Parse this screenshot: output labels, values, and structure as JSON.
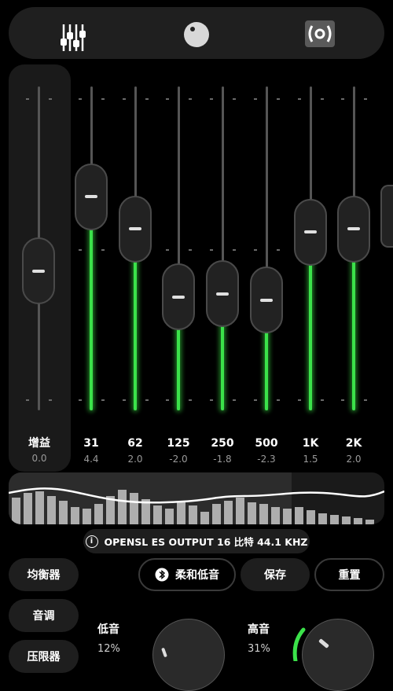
{
  "topbar": {
    "icons": [
      "equalizer-sliders-icon",
      "knob-icon",
      "surround-sound-icon"
    ]
  },
  "gain": {
    "label": "增益",
    "value": "0.0",
    "level": 0.43
  },
  "bands": [
    {
      "freq": "31",
      "value": "4.4",
      "level": 0.66
    },
    {
      "freq": "62",
      "value": "2.0",
      "level": 0.56
    },
    {
      "freq": "125",
      "value": "-2.0",
      "level": 0.35
    },
    {
      "freq": "250",
      "value": "-1.8",
      "level": 0.36
    },
    {
      "freq": "500",
      "value": "-2.3",
      "level": 0.34
    },
    {
      "freq": "1K",
      "value": "1.5",
      "level": 0.55
    },
    {
      "freq": "2K",
      "value": "2.0",
      "level": 0.56
    }
  ],
  "info": {
    "text": "OPENSL ES OUTPUT  16 比特  44.1 KHZ"
  },
  "side_menu": {
    "equalizer": "均衡器",
    "tone": "音调",
    "limiter": "压限器"
  },
  "actions": {
    "preset": "柔和低音",
    "save": "保存",
    "reset": "重置"
  },
  "knobs": {
    "bass": {
      "label": "低音",
      "value": "12%"
    },
    "treble": {
      "label": "高音",
      "value": "31%"
    }
  },
  "colors": {
    "accent_green": "#3be24a",
    "background": "#000000"
  }
}
